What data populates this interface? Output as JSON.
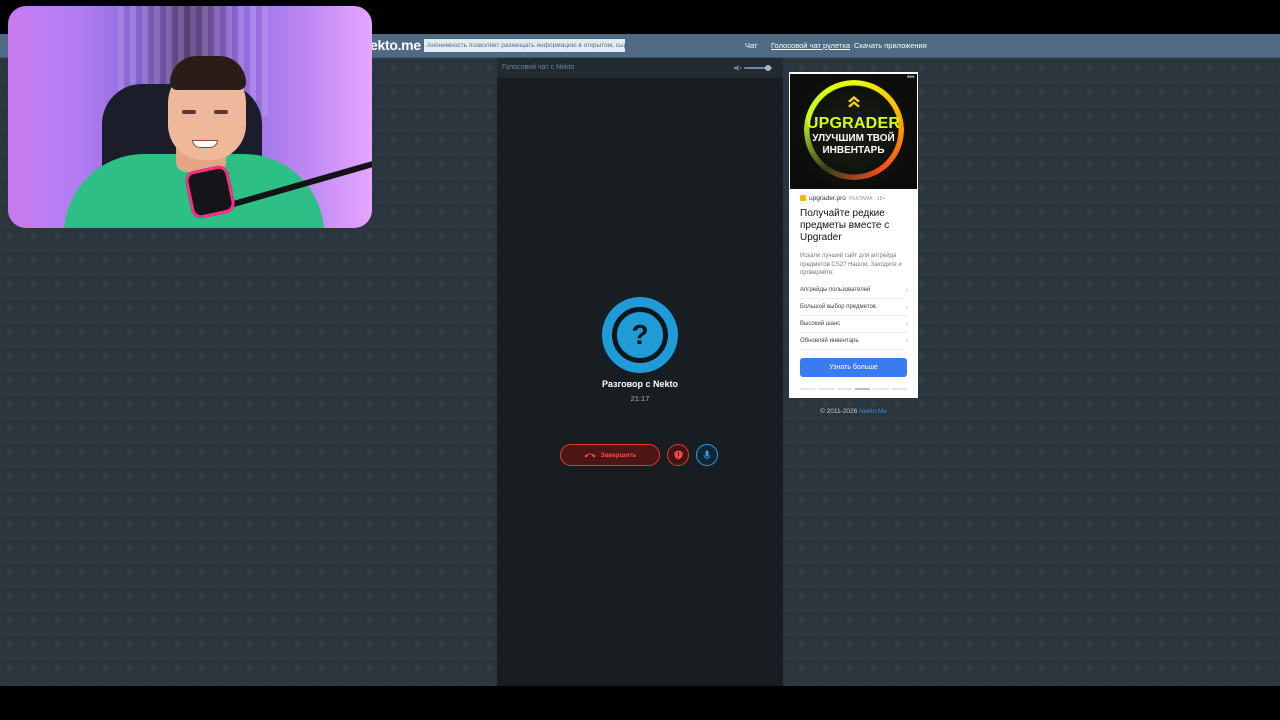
{
  "site": {
    "logo": "ekto.me",
    "notice": "Анонимность позволяет размещать информацию в открытом, сыром виде",
    "nav": [
      {
        "label": "Чат",
        "active": false
      },
      {
        "label": "Голосовой чат рулетка",
        "active": true
      },
      {
        "label": "Скачать приложения",
        "active": false
      }
    ]
  },
  "chat": {
    "header_title": "Голосовой чат с Nekto",
    "volume_level": 0.85,
    "avatar_symbol": "?",
    "conversation_title": "Разговор с Nekto",
    "timer": "21:17",
    "end_button_label": "Завершить",
    "accent_color": "#1f9bd7",
    "danger_color": "#e03b36"
  },
  "ad": {
    "banner_word": "UPGRADER",
    "banner_tagline": "УЛУЧШИМ ТВОЙ ИНВЕНТАРЬ",
    "source": "upgrader.pro",
    "source_tag": "РЕКЛАМА · 18+",
    "title": "Получайте редкие предметы вместе с Upgrader",
    "description": "Искали лучший сайт для апгрейда предметов CS2? Нашли. Заходите и проверяйте.",
    "list": [
      "Апгрейды пользователей",
      "Большой выбор предметов",
      "Высокий шанс",
      "Обновляй инвентарь"
    ],
    "cta": "Узнать больше",
    "cta_color": "#3b7bf0"
  },
  "footer": {
    "copyright": "© 2011-2026",
    "link": "Nekto.Me"
  }
}
